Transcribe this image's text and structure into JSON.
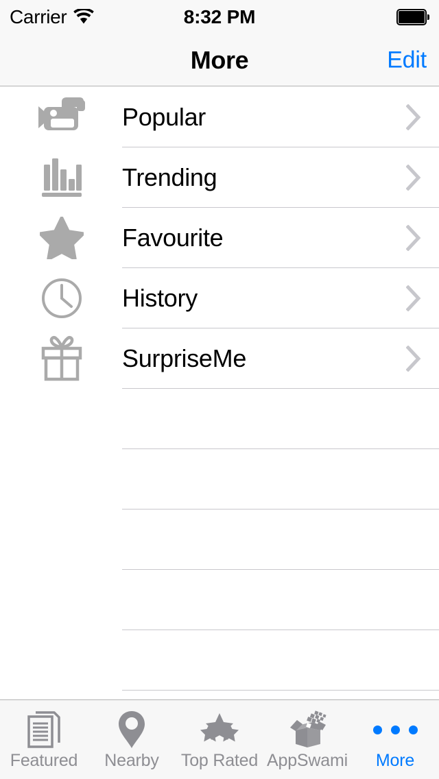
{
  "status_bar": {
    "carrier": "Carrier",
    "wifi_icon": "wifi-icon",
    "time": "8:32 PM",
    "battery_icon": "battery-full-icon"
  },
  "nav_bar": {
    "title": "More",
    "edit_label": "Edit",
    "accent_color": "#007aff"
  },
  "list": {
    "rows": [
      {
        "label": "Popular",
        "icon": "video-camera-icon",
        "accessory": "chevron-right-icon"
      },
      {
        "label": "Trending",
        "icon": "bar-chart-icon",
        "accessory": "chevron-right-icon"
      },
      {
        "label": "Favourite",
        "icon": "star-icon",
        "accessory": "chevron-right-icon"
      },
      {
        "label": "History",
        "icon": "clock-icon",
        "accessory": "chevron-right-icon"
      },
      {
        "label": "SurpriseMe",
        "icon": "gift-icon",
        "accessory": "chevron-right-icon"
      }
    ],
    "empty_row_count": 5,
    "separator_color": "#c8c7cc",
    "icon_color": "#aaaaaa"
  },
  "tab_bar": {
    "items": [
      {
        "label": "Featured",
        "icon": "documents-icon",
        "active": false
      },
      {
        "label": "Nearby",
        "icon": "map-pin-icon",
        "active": false
      },
      {
        "label": "Top Rated",
        "icon": "stars-icon",
        "active": false
      },
      {
        "label": "AppSwami",
        "icon": "open-box-icon",
        "active": false
      },
      {
        "label": "More",
        "icon": "ellipsis-icon",
        "active": true
      }
    ],
    "inactive_color": "#8e8e93",
    "active_color": "#007aff"
  }
}
